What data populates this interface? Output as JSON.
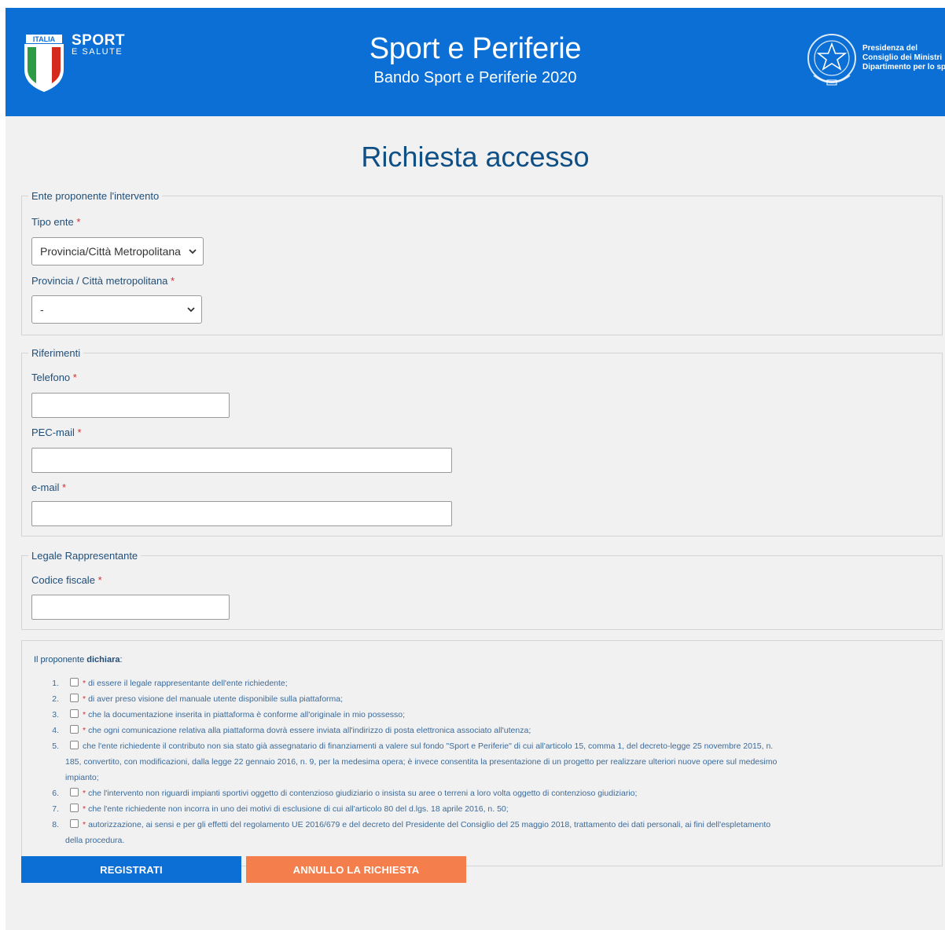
{
  "header": {
    "brand": {
      "flag_text": "ITALIA",
      "sport": "SPORT",
      "salute": "E SALUTE"
    },
    "title": "Sport e Periferie",
    "subtitle": "Bando Sport e Periferie 2020",
    "gov_lines": [
      "Presidenza del",
      "Consiglio dei Ministri",
      "Dipartimento per lo sport"
    ]
  },
  "colors": {
    "header_bg": "#0b6fd6",
    "heading": "#0e4f86",
    "primary_button": "#0b6fd6",
    "secondary_button": "#f47f4c",
    "required": "#d32f2f"
  },
  "page_title": "Richiesta accesso",
  "sections": {
    "ente": {
      "legend": "Ente proponente l'intervento",
      "tipo_label": "Tipo ente",
      "tipo_value": "Provincia/Città Metropolitana",
      "provincia_label": "Provincia / Città metropolitana",
      "provincia_value": "-"
    },
    "riferimenti": {
      "legend": "Riferimenti",
      "telefono_label": "Telefono",
      "telefono_value": "",
      "pec_label": "PEC-mail",
      "pec_value": "",
      "email_label": "e-mail",
      "email_value": ""
    },
    "legale": {
      "legend": "Legale Rappresentante",
      "cf_label": "Codice fiscale",
      "cf_value": ""
    }
  },
  "required_mark": "*",
  "declarations": {
    "intro_prefix": "Il proponente ",
    "intro_bold": "dichiara",
    "intro_suffix": ":",
    "items": [
      {
        "num": "1.",
        "lines": [
          "di essere il legale rappresentante dell'ente richiedente;"
        ],
        "required": true
      },
      {
        "num": "2.",
        "lines": [
          "di aver preso visione del manuale utente disponibile sulla piattaforma;"
        ],
        "required": true
      },
      {
        "num": "3.",
        "lines": [
          "che la documentazione inserita in piattaforma è conforme all'originale in mio possesso;"
        ],
        "required": true
      },
      {
        "num": "4.",
        "lines": [
          "che ogni comunicazione relativa alla piattaforma dovrà essere inviata all'indirizzo di posta elettronica associato all'utenza;"
        ],
        "required": true
      },
      {
        "num": "5.",
        "lines": [
          "che l'ente richiedente il contributo non sia stato già assegnatario di finanziamenti a valere sul fondo \"Sport e Periferie\" di cui all'articolo 15, comma 1, del decreto-legge 25 novembre 2015, n.",
          "185, convertito, con modificazioni, dalla legge 22 gennaio 2016, n. 9, per la medesima opera; è invece consentita la presentazione di un progetto per realizzare ulteriori nuove opere sul medesimo",
          "impianto;"
        ],
        "required": false
      },
      {
        "num": "6.",
        "lines": [
          "che l'intervento non riguardi impianti sportivi oggetto di contenzioso giudiziario o insista su aree o terreni a loro volta oggetto di contenzioso giudiziario;"
        ],
        "required": true
      },
      {
        "num": "7.",
        "lines": [
          "che l'ente richiedente non incorra in uno dei motivi di esclusione di cui all'articolo 80 del d.lgs. 18 aprile 2016, n. 50;"
        ],
        "required": true
      },
      {
        "num": "8.",
        "lines": [
          "autorizzazione, ai sensi e per gli effetti del regolamento UE 2016/679 e del decreto del Presidente del Consiglio del 25 maggio 2018, trattamento dei dati personali, ai fini dell'espletamento",
          "della procedura."
        ],
        "required": true
      }
    ]
  },
  "buttons": {
    "register": "REGISTRATI",
    "cancel": "ANNULLO LA RICHIESTA"
  }
}
